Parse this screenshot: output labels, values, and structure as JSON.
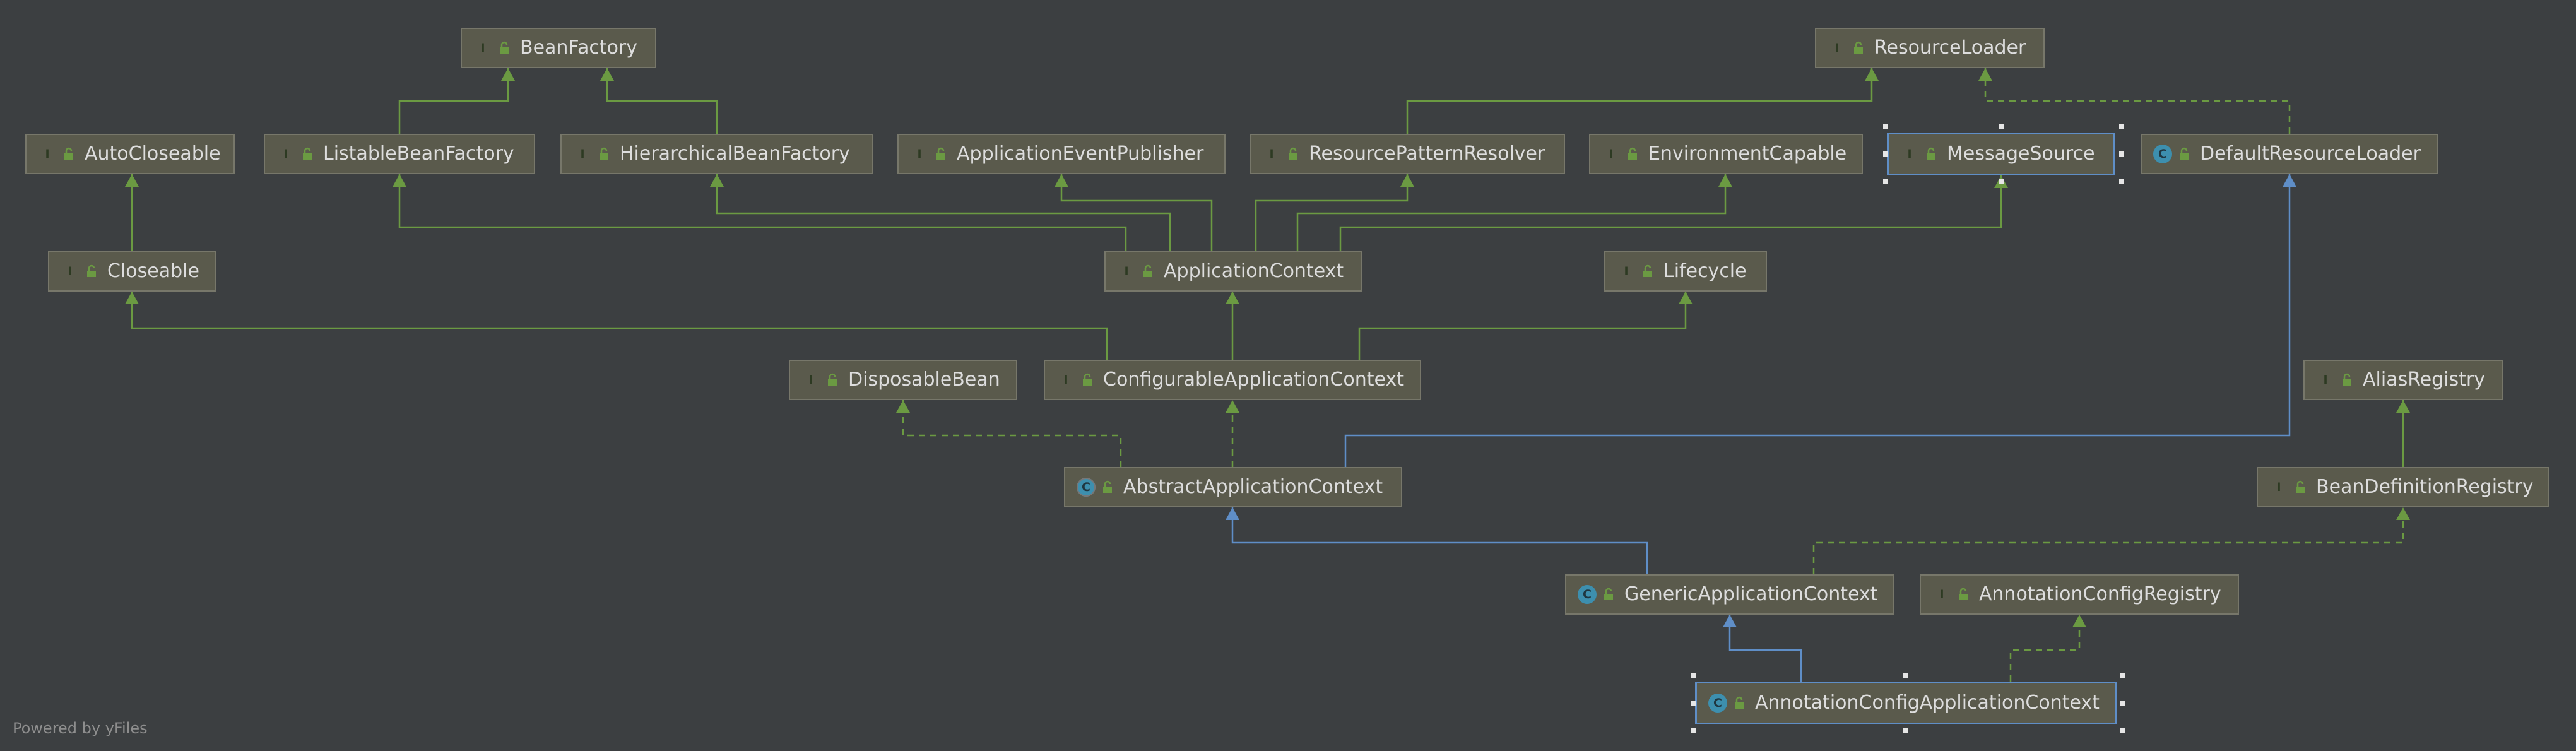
{
  "diagram": {
    "colors": {
      "background": "#3c3f41",
      "extends_edge": "#6b9a42",
      "class_extends_edge": "#5f8ec7",
      "implements_edge": "#6b9a42"
    },
    "nodes": {
      "BeanFactory": {
        "label": "BeanFactory",
        "kind": "interface"
      },
      "ResourceLoader": {
        "label": "ResourceLoader",
        "kind": "interface"
      },
      "AutoCloseable": {
        "label": "AutoCloseable",
        "kind": "interface"
      },
      "ListableBeanFactory": {
        "label": "ListableBeanFactory",
        "kind": "interface"
      },
      "HierarchicalBeanFactory": {
        "label": "HierarchicalBeanFactory",
        "kind": "interface"
      },
      "ApplicationEventPublisher": {
        "label": "ApplicationEventPublisher",
        "kind": "interface"
      },
      "ResourcePatternResolver": {
        "label": "ResourcePatternResolver",
        "kind": "interface"
      },
      "EnvironmentCapable": {
        "label": "EnvironmentCapable",
        "kind": "interface"
      },
      "MessageSource": {
        "label": "MessageSource",
        "kind": "interface"
      },
      "DefaultResourceLoader": {
        "label": "DefaultResourceLoader",
        "kind": "class"
      },
      "Closeable": {
        "label": "Closeable",
        "kind": "interface"
      },
      "ApplicationContext": {
        "label": "ApplicationContext",
        "kind": "interface"
      },
      "Lifecycle": {
        "label": "Lifecycle",
        "kind": "interface"
      },
      "DisposableBean": {
        "label": "DisposableBean",
        "kind": "interface"
      },
      "ConfigurableApplicationContext": {
        "label": "ConfigurableApplicationContext",
        "kind": "interface"
      },
      "AliasRegistry": {
        "label": "AliasRegistry",
        "kind": "interface"
      },
      "AbstractApplicationContext": {
        "label": "AbstractApplicationContext",
        "kind": "abstract"
      },
      "BeanDefinitionRegistry": {
        "label": "BeanDefinitionRegistry",
        "kind": "interface"
      },
      "GenericApplicationContext": {
        "label": "GenericApplicationContext",
        "kind": "class"
      },
      "AnnotationConfigRegistry": {
        "label": "AnnotationConfigRegistry",
        "kind": "interface"
      },
      "AnnotationConfigApplicationContext": {
        "label": "AnnotationConfigApplicationContext",
        "kind": "class"
      }
    },
    "badge_letters": {
      "interface": "I",
      "class": "C",
      "abstract": "C"
    },
    "edges": [
      {
        "from": "ListableBeanFactory",
        "to": "BeanFactory",
        "type": "extends"
      },
      {
        "from": "HierarchicalBeanFactory",
        "to": "BeanFactory",
        "type": "extends"
      },
      {
        "from": "ResourcePatternResolver",
        "to": "ResourceLoader",
        "type": "extends"
      },
      {
        "from": "DefaultResourceLoader",
        "to": "ResourceLoader",
        "type": "implements"
      },
      {
        "from": "Closeable",
        "to": "AutoCloseable",
        "type": "extends"
      },
      {
        "from": "ApplicationContext",
        "to": "ListableBeanFactory",
        "type": "extends"
      },
      {
        "from": "ApplicationContext",
        "to": "HierarchicalBeanFactory",
        "type": "extends"
      },
      {
        "from": "ApplicationContext",
        "to": "ApplicationEventPublisher",
        "type": "extends"
      },
      {
        "from": "ApplicationContext",
        "to": "ResourcePatternResolver",
        "type": "extends"
      },
      {
        "from": "ApplicationContext",
        "to": "EnvironmentCapable",
        "type": "extends"
      },
      {
        "from": "ApplicationContext",
        "to": "MessageSource",
        "type": "extends"
      },
      {
        "from": "ConfigurableApplicationContext",
        "to": "ApplicationContext",
        "type": "extends"
      },
      {
        "from": "ConfigurableApplicationContext",
        "to": "Closeable",
        "type": "extends"
      },
      {
        "from": "ConfigurableApplicationContext",
        "to": "Lifecycle",
        "type": "extends"
      },
      {
        "from": "AbstractApplicationContext",
        "to": "ConfigurableApplicationContext",
        "type": "implements"
      },
      {
        "from": "AbstractApplicationContext",
        "to": "DisposableBean",
        "type": "implements"
      },
      {
        "from": "AbstractApplicationContext",
        "to": "DefaultResourceLoader",
        "type": "class-extends"
      },
      {
        "from": "BeanDefinitionRegistry",
        "to": "AliasRegistry",
        "type": "extends"
      },
      {
        "from": "GenericApplicationContext",
        "to": "AbstractApplicationContext",
        "type": "class-extends"
      },
      {
        "from": "GenericApplicationContext",
        "to": "BeanDefinitionRegistry",
        "type": "implements"
      },
      {
        "from": "AnnotationConfigApplicationContext",
        "to": "GenericApplicationContext",
        "type": "class-extends"
      },
      {
        "from": "AnnotationConfigApplicationContext",
        "to": "AnnotationConfigRegistry",
        "type": "implements"
      }
    ],
    "selected": [
      "MessageSource",
      "AnnotationConfigApplicationContext"
    ],
    "footer": "Powered by yFiles"
  }
}
